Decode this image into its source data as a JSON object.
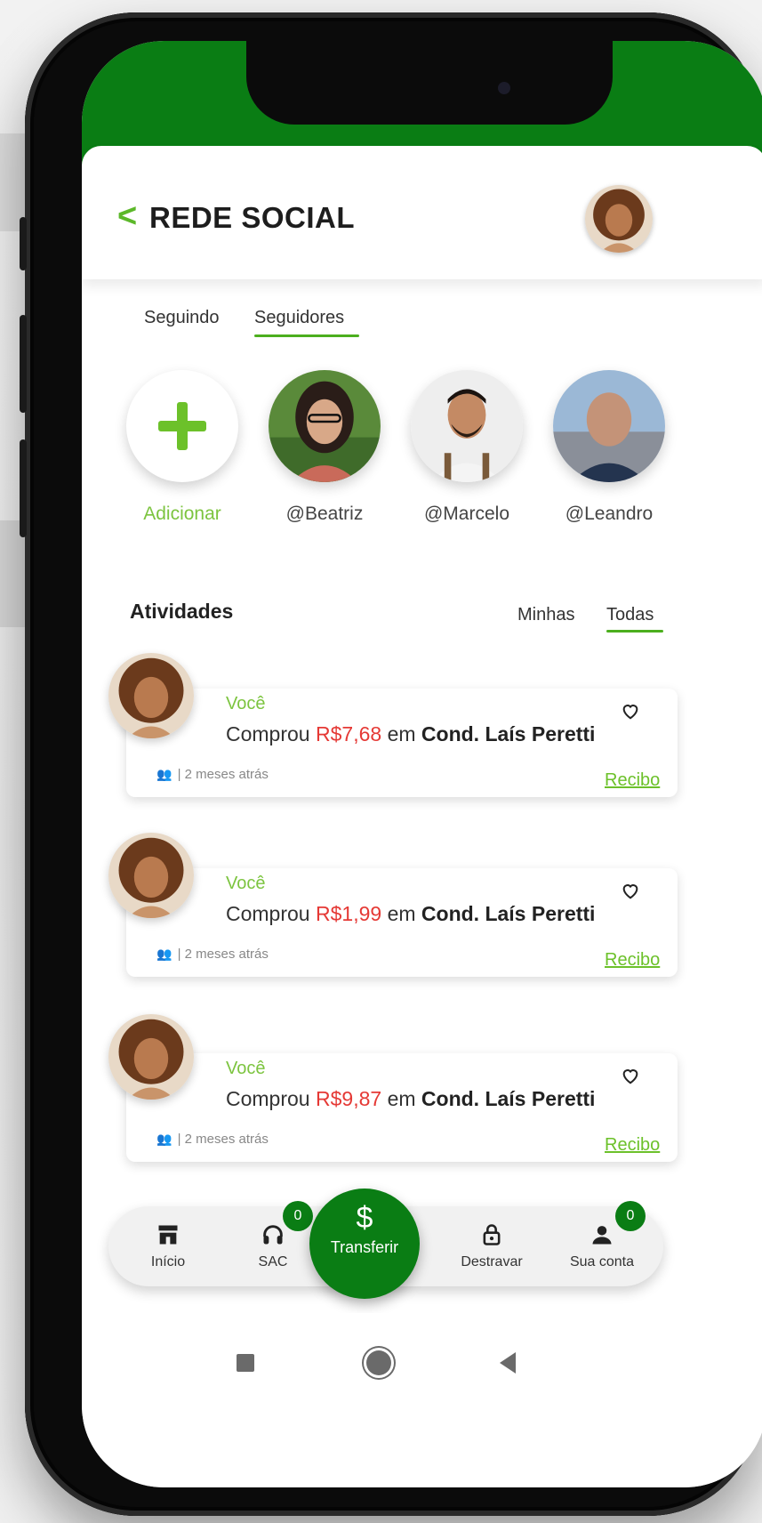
{
  "header": {
    "back_icon": "chevron-left-icon",
    "title": "REDE SOCIAL"
  },
  "tabs": {
    "following": "Seguindo",
    "followers": "Seguidores",
    "active": "Seguidores"
  },
  "stories": [
    {
      "label": "Adicionar"
    },
    {
      "label": "@Beatriz"
    },
    {
      "label": "@Marcelo"
    },
    {
      "label": "@Leandro"
    }
  ],
  "activities": {
    "title": "Atividades",
    "filter_mine": "Minhas",
    "filter_all": "Todas",
    "active_filter": "Todas",
    "items": [
      {
        "who": "Você",
        "verb": "Comprou",
        "amount": "R$7,68",
        "prep": "em",
        "place": "Cond. Laís Peretti",
        "time": "| 2 meses atrás",
        "link": "Recibo"
      },
      {
        "who": "Você",
        "verb": "Comprou",
        "amount": "R$1,99",
        "prep": "em",
        "place": "Cond. Laís Peretti",
        "time": "| 2 meses atrás",
        "link": "Recibo"
      },
      {
        "who": "Você",
        "verb": "Comprou",
        "amount": "R$9,87",
        "prep": "em",
        "place": "Cond. Laís Peretti",
        "time": "| 2 meses atrás",
        "link": "Recibo"
      }
    ]
  },
  "nav": {
    "home": "Início",
    "support": "SAC",
    "support_badge": "0",
    "transfer": "Transferir",
    "transfer_symbol": "$",
    "unlock": "Destravar",
    "account": "Sua conta",
    "account_badge": "0"
  },
  "colors": {
    "brand_green": "#0a7d14",
    "accent_green": "#6cc12a",
    "amount_red": "#e53935"
  }
}
